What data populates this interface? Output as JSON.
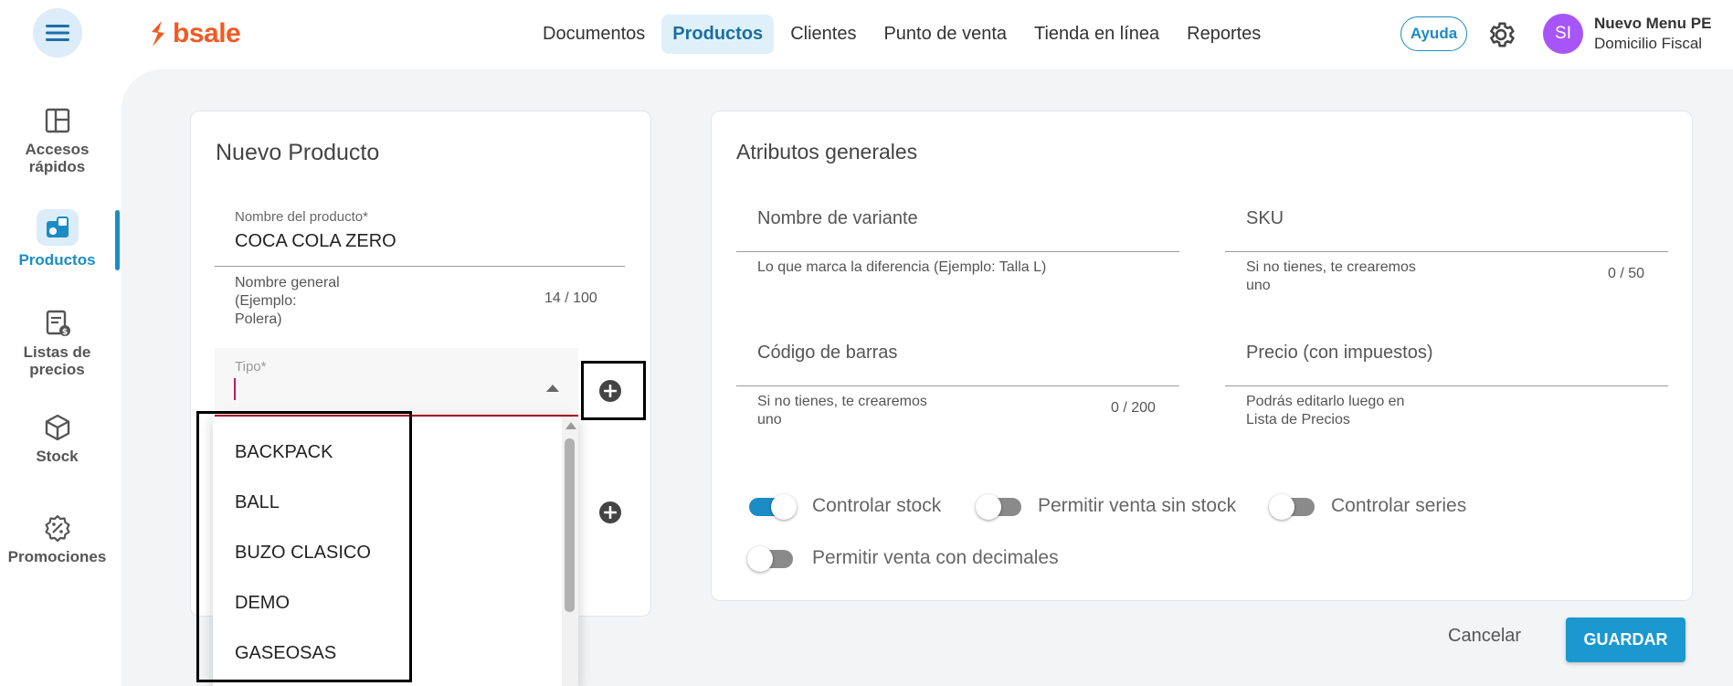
{
  "header": {
    "logo_text": "bsale",
    "nav": [
      {
        "label": "Documentos"
      },
      {
        "label": "Productos"
      },
      {
        "label": "Clientes"
      },
      {
        "label": "Punto de venta"
      },
      {
        "label": "Tienda en línea"
      },
      {
        "label": "Reportes"
      }
    ],
    "active_nav": "Productos",
    "help_label": "Ayuda",
    "avatar_initials": "SI",
    "user_name": "Nuevo Menu PE",
    "user_sub": "Domicilio Fiscal"
  },
  "sidebar": {
    "items": [
      {
        "label_line1": "Accesos",
        "label_line2": "rápidos"
      },
      {
        "label_line1": "Productos",
        "label_line2": ""
      },
      {
        "label_line1": "Listas de",
        "label_line2": "precios"
      },
      {
        "label_line1": "Stock",
        "label_line2": ""
      },
      {
        "label_line1": "Promociones",
        "label_line2": ""
      }
    ],
    "active": "Productos"
  },
  "product_card": {
    "title": "Nuevo Producto",
    "name_field": {
      "label": "Nombre del producto*",
      "value": "COCA COLA ZERO",
      "helper_line1": "Nombre general",
      "helper_line2": "(Ejemplo:",
      "helper_line3": "Polera)",
      "counter": "14 / 100"
    },
    "tipo_field": {
      "label": "Tipo*",
      "value": ""
    }
  },
  "tipo_dropdown": {
    "options": [
      "BACKPACK",
      "BALL",
      "BUZO CLASICO",
      "DEMO",
      "GASEOSAS"
    ]
  },
  "attributes_card": {
    "title": "Atributos generales",
    "variant_name": {
      "placeholder": "Nombre de variante",
      "helper": "Lo que marca la diferencia (Ejemplo: Talla L)"
    },
    "sku": {
      "placeholder": "SKU",
      "helper_line1": "Si no tienes, te crearemos",
      "helper_line2": "uno",
      "counter": "0 / 50"
    },
    "barcode": {
      "placeholder": "Código de barras",
      "helper_line1": "Si no tienes, te crearemos",
      "helper_line2": "uno",
      "counter": "0 / 200"
    },
    "price": {
      "placeholder": "Precio (con impuestos)",
      "helper_line1": "Podrás editarlo luego en",
      "helper_line2": "Lista de Precios"
    },
    "toggles": [
      {
        "label": "Controlar stock",
        "on": true
      },
      {
        "label": "Permitir venta sin stock",
        "on": false
      },
      {
        "label": "Controlar series",
        "on": false
      },
      {
        "label": "Permitir venta con decimales",
        "on": false
      }
    ]
  },
  "actions": {
    "cancel_label": "Cancelar",
    "save_label": "GUARDAR"
  },
  "colors": {
    "accent": "#1b8cc4",
    "brand": "#f15a24",
    "error_underline": "#b00020",
    "avatar": "#a855f7"
  }
}
